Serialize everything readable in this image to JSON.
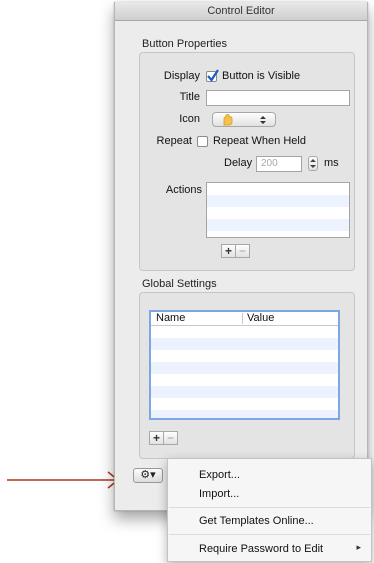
{
  "window": {
    "title": "Control Editor"
  },
  "button_properties": {
    "section_title": "Button Properties",
    "display_label": "Display",
    "visible_checkbox_label": "Button is Visible",
    "visible_checked": true,
    "title_label": "Title",
    "title_value": "",
    "icon_label": "Icon",
    "repeat_label": "Repeat",
    "repeat_checkbox_label": "Repeat When Held",
    "repeat_checked": false,
    "delay_label": "Delay",
    "delay_value": "200",
    "delay_unit": "ms",
    "actions_label": "Actions",
    "add_label": "+",
    "remove_label": "−"
  },
  "global_settings": {
    "section_title": "Global Settings",
    "columns": [
      "Name",
      "Value"
    ],
    "add_label": "+",
    "remove_label": "−"
  },
  "gear_menu": {
    "button_glyph": "⚙▾",
    "items": [
      "Export...",
      "Import...",
      "Get Templates Online...",
      "Require Password to Edit"
    ],
    "submenu_arrow": "▸"
  },
  "colors": {
    "accent_select": "#7ea6e0",
    "arrow": "#b0321d",
    "row_alt": "#edf3fe"
  },
  "icons": [
    "checkmark-icon",
    "hand-icon",
    "popup-arrows-icon",
    "stepper-icon",
    "gear-icon",
    "chevron-down-icon",
    "arrow-right-icon",
    "submenu-arrow-icon"
  ]
}
